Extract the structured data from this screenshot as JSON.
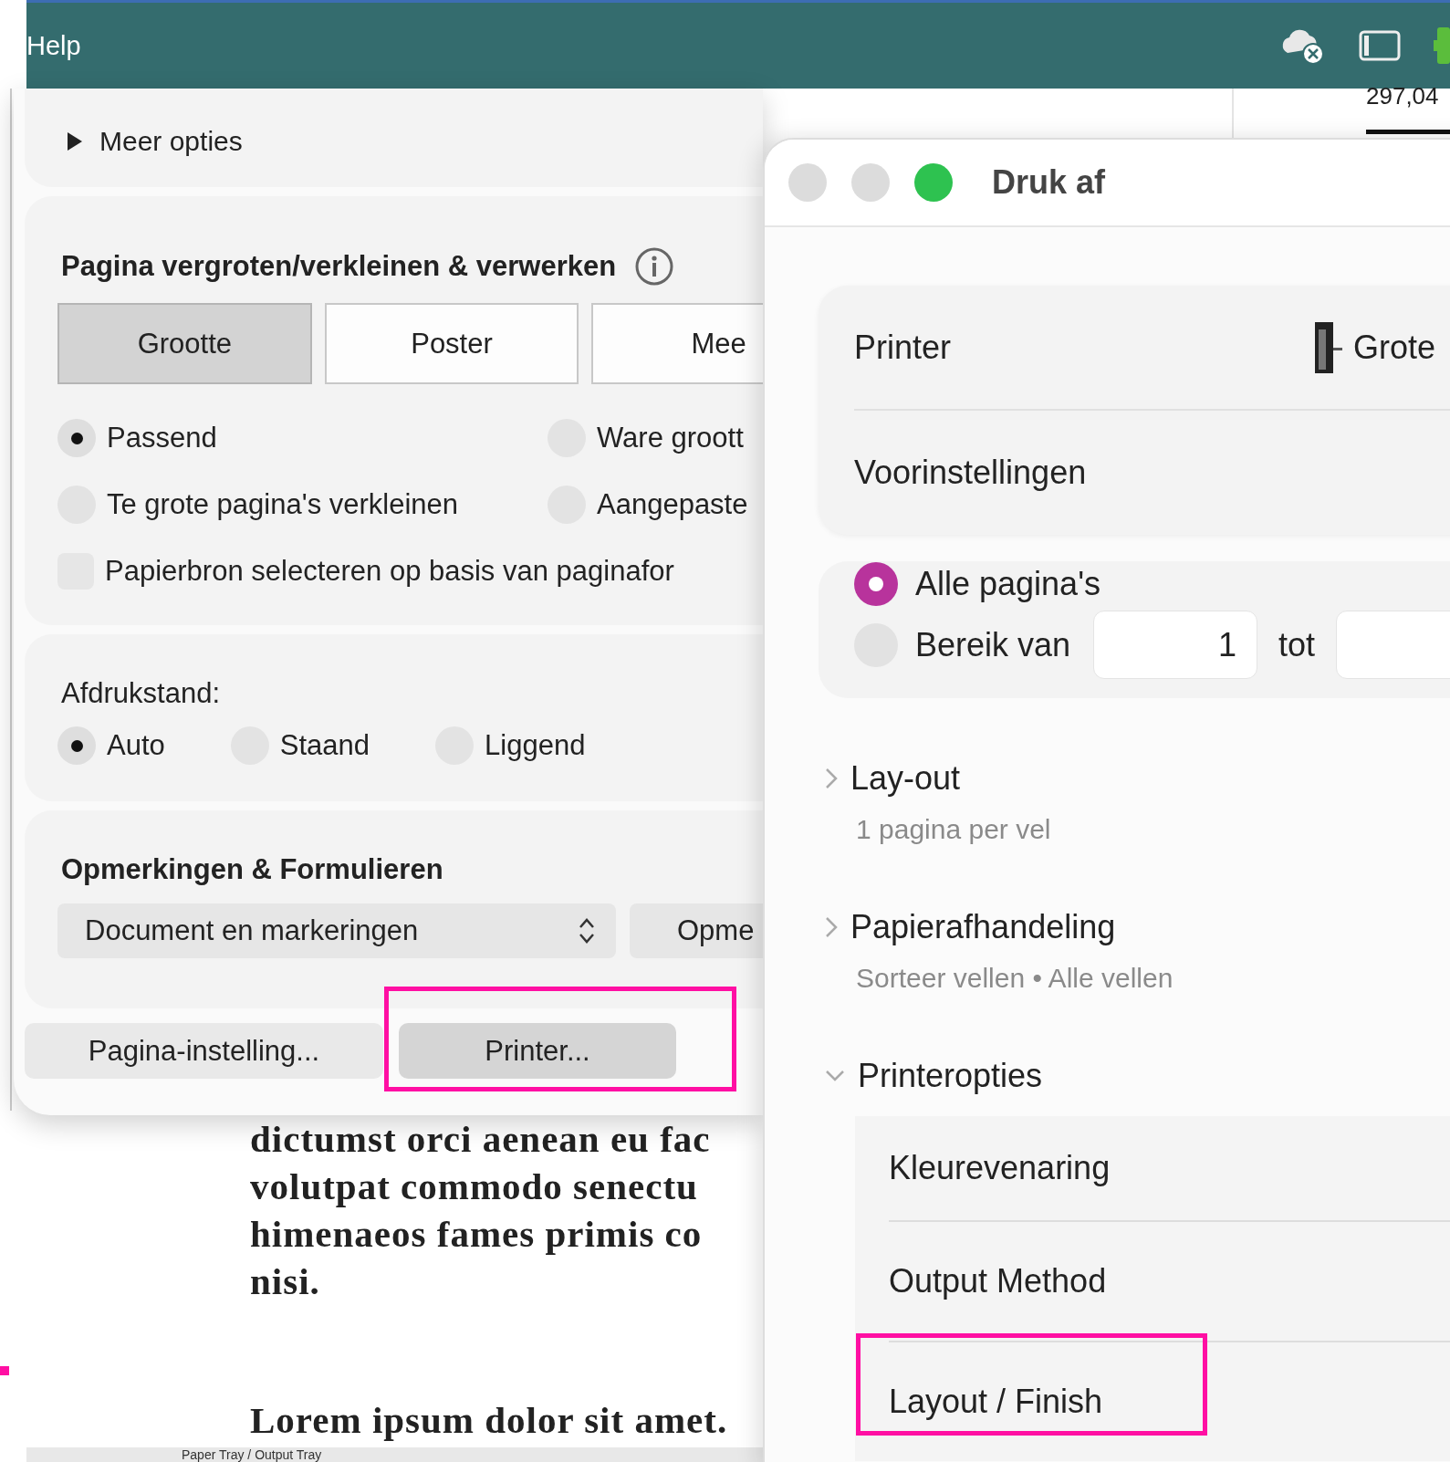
{
  "top_bar": {
    "menu_label": "Help"
  },
  "ruler_reading": "297,04",
  "settings_panel": {
    "more_options": "Meer opties",
    "scaling": {
      "title": "Pagina vergroten/verkleinen & verwerken",
      "segments": [
        {
          "label": "Grootte",
          "selected": true
        },
        {
          "label": "Poster",
          "selected": false
        },
        {
          "label": "Mee",
          "selected": false
        }
      ],
      "options": [
        {
          "kind": "radio",
          "label": "Passend",
          "selected": true
        },
        {
          "kind": "radio",
          "label": "Ware groott",
          "selected": false
        },
        {
          "kind": "radio",
          "label": "Te grote pagina's verkleinen",
          "selected": false
        },
        {
          "kind": "radio",
          "label": "Aangepaste",
          "selected": false
        },
        {
          "kind": "checkbox",
          "label": "Papierbron selecteren op basis van paginafor",
          "checked": false
        }
      ]
    },
    "orientation": {
      "label": "Afdrukstand:",
      "options": [
        {
          "label": "Auto",
          "selected": true
        },
        {
          "label": "Staand",
          "selected": false
        },
        {
          "label": "Liggend",
          "selected": false
        }
      ]
    },
    "annotations": {
      "title": "Opmerkingen & Formulieren",
      "select_value": "Document en markeringen",
      "button": "Opme"
    },
    "buttons": [
      {
        "label": "Pagina-instelling...",
        "highlighted": false
      },
      {
        "label": "Printer...",
        "highlighted": true
      }
    ]
  },
  "document": {
    "lines": [
      "dictumst orci aenean eu fac",
      "volutpat commodo senectu",
      "himenaeos fames primis co",
      "nisi."
    ],
    "footer_line": "Lorem ipsum dolor sit amet.",
    "tray_label": "Paper Tray / Output Tray"
  },
  "print_dialog": {
    "title": "Druk af",
    "printer_label": "Printer",
    "printer_value": "Grote",
    "presets_label": "Voorinstellingen",
    "pages": {
      "options": [
        {
          "label": "Alle pagina's",
          "selected": true
        },
        {
          "label": "Bereik van",
          "selected": false
        }
      ],
      "from_value": "1",
      "to_label": "tot"
    },
    "sections": [
      {
        "title": "Lay-out",
        "summary": "1 pagina per vel",
        "expanded": false
      },
      {
        "title": "Papierafhandeling",
        "summary": "Sorteer vellen • Alle vellen",
        "expanded": false
      },
      {
        "title": "Printeropties",
        "expanded": true,
        "children": [
          {
            "label": "Kleurevenaring",
            "highlighted": false
          },
          {
            "label": "Output Method",
            "highlighted": false
          },
          {
            "label": "Layout / Finish",
            "highlighted": true
          }
        ]
      }
    ]
  }
}
